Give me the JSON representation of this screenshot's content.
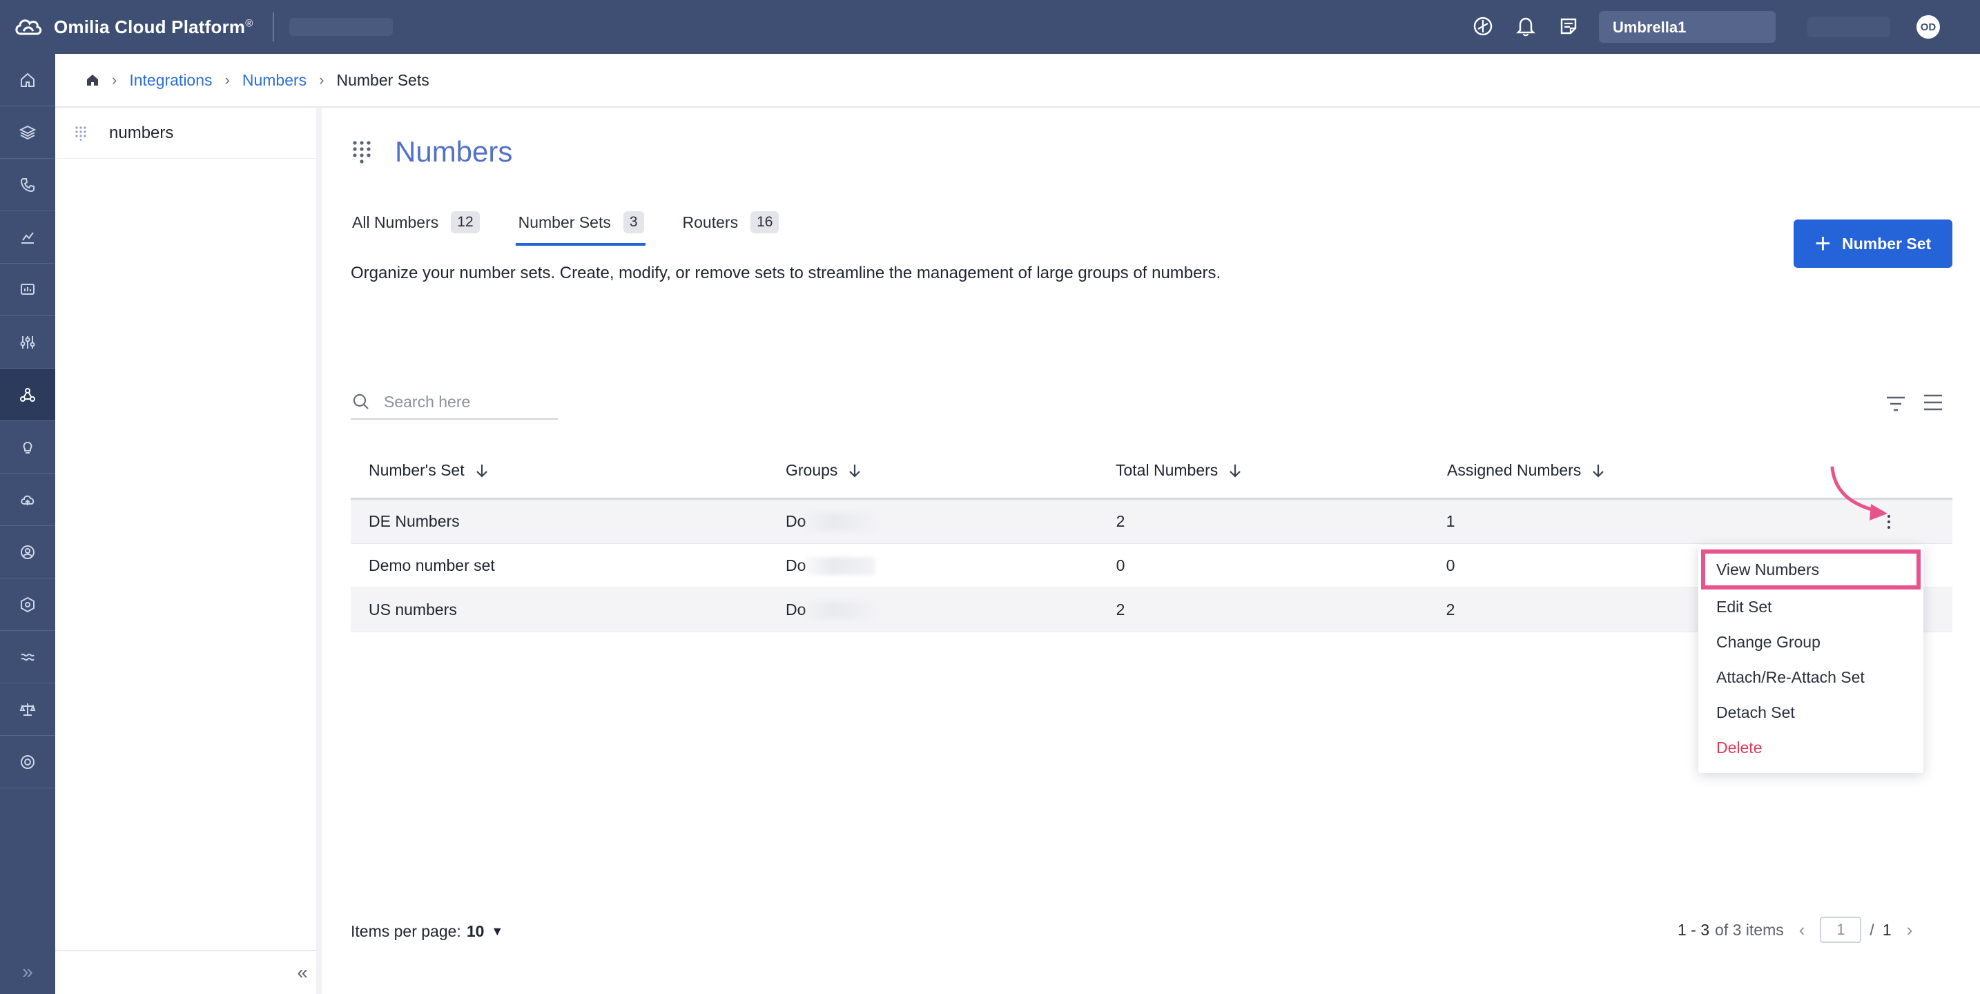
{
  "app": {
    "name": "Omilia Cloud Platform",
    "registered_mark": "®",
    "tenant": "Umbrella1",
    "avatar_initials": "OD"
  },
  "topbar": {
    "icons": [
      "dashboard-icon",
      "bell-icon",
      "notes-icon"
    ]
  },
  "rail": {
    "items": [
      "home-icon",
      "layers-icon",
      "phone-icon",
      "analytics-icon",
      "monitor-icon",
      "sliders-icon",
      "integrations-icon",
      "lightbulb-icon",
      "cloud-icon",
      "support-icon",
      "hexagon-icon",
      "wave-icon",
      "scale-icon",
      "globe-icon"
    ],
    "active_index": 6,
    "expand_label": "»"
  },
  "breadcrumb": {
    "items": [
      "Integrations",
      "Numbers"
    ],
    "current": "Number Sets"
  },
  "sidepanel": {
    "items": [
      "numbers"
    ],
    "collapse_label": "«"
  },
  "page": {
    "title": "Numbers",
    "description": "Organize your number sets. Create, modify, or remove sets to streamline the management of large groups of numbers.",
    "tabs": [
      {
        "label": "All Numbers",
        "count": "12"
      },
      {
        "label": "Number Sets",
        "count": "3"
      },
      {
        "label": "Routers",
        "count": "16"
      }
    ],
    "active_tab": 1,
    "primary_button": {
      "icon": "+",
      "label": "Number Set"
    }
  },
  "search": {
    "placeholder": "Search here",
    "value": ""
  },
  "table": {
    "columns": [
      "Number's Set",
      "Groups",
      "Total Numbers",
      "Assigned Numbers"
    ],
    "rows": [
      {
        "set": "DE Numbers",
        "groups": "Do",
        "total": "2",
        "assigned": "1"
      },
      {
        "set": "Demo number set",
        "groups": "Do",
        "total": "0",
        "assigned": "0"
      },
      {
        "set": "US numbers",
        "groups": "Do",
        "total": "2",
        "assigned": "2"
      }
    ]
  },
  "menu": {
    "items": [
      "View Numbers",
      "Edit Set",
      "Change Group",
      "Attach/Re-Attach Set",
      "Detach Set",
      "Delete"
    ],
    "highlighted": "View Numbers"
  },
  "pagination": {
    "items_per_page_label": "Items per page:",
    "items_per_page": "10",
    "range": "1 - 3",
    "range_suffix": "of 3 items",
    "current_page": "1",
    "separator": "/",
    "total_pages": "1",
    "prev": "‹",
    "next": "›"
  },
  "colors": {
    "topbar": "#3f4f74",
    "accent": "#2463d8",
    "title": "#5272c8",
    "highlight": "#e8528d",
    "danger": "#d93c57"
  }
}
